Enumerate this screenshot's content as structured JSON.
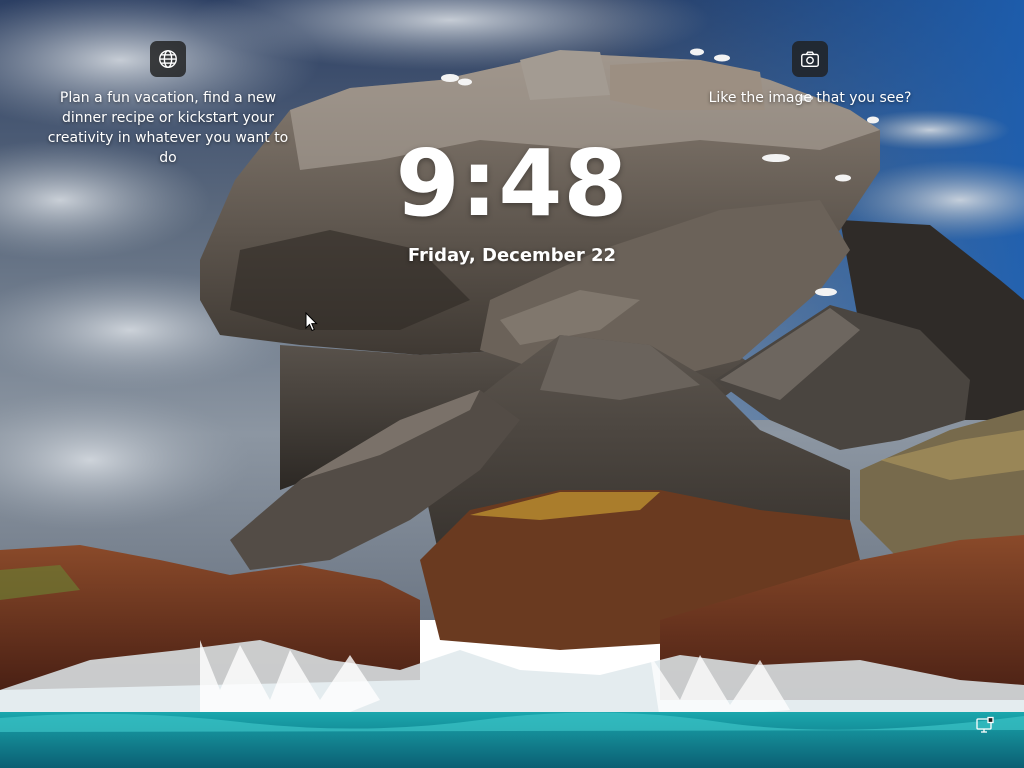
{
  "lock_screen": {
    "time": "9:48",
    "date": "Friday, December 22"
  },
  "spotlight": {
    "left_tip": "Plan a fun vacation, find a new dinner recipe or kickstart your creativity in whatever you want to do",
    "right_tip": "Like the image that you see?",
    "left_icon": "globe-icon",
    "right_icon": "camera-icon"
  },
  "system_tray": {
    "icon": "network-icon"
  },
  "colors": {
    "sky_top": "#2f4f7f",
    "cloud": "#9aa3ae",
    "rock": "#5a5148",
    "seaweed": "#7a3a22",
    "water": "#1fa3a8",
    "text": "#ffffff"
  }
}
